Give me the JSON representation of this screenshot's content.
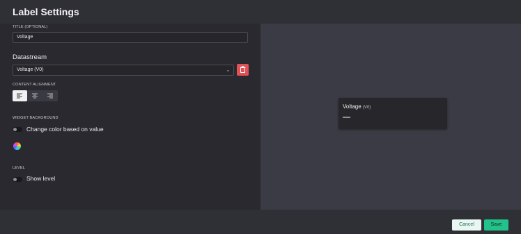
{
  "header": {
    "title": "Label Settings"
  },
  "title_field": {
    "label": "TITLE (OPTIONAL)",
    "value": "Voltage"
  },
  "datastream": {
    "heading": "Datastream",
    "selected": "Voltage (V0)",
    "delete_icon": "trash-icon"
  },
  "alignment": {
    "label": "CONTENT ALIGNMENT",
    "options": [
      "align-left-icon",
      "align-center-icon",
      "align-right-icon"
    ],
    "active_index": 0
  },
  "background": {
    "label": "WIDGET BACKGROUND",
    "toggle_label": "Change color based on value",
    "toggle_on": false,
    "color_icon": "color-wheel-icon"
  },
  "level": {
    "label": "LEVEL",
    "toggle_label": "Show level",
    "toggle_on": false
  },
  "preview": {
    "title": "Voltage",
    "pin": "(V0)",
    "value": "—"
  },
  "footer": {
    "cancel_label": "Cancel",
    "save_label": "Save"
  },
  "colors": {
    "accent": "#22c28a",
    "danger": "#e05257",
    "panel": "#29292f",
    "preview_bg": "#3b3b45"
  }
}
